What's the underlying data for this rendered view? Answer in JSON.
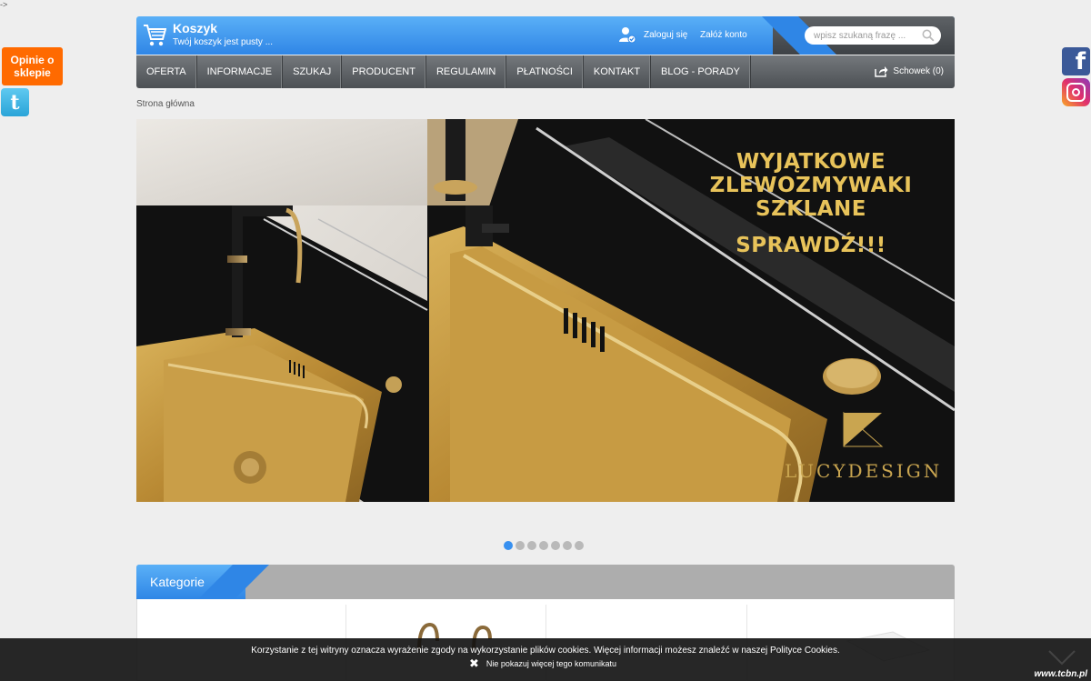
{
  "corner_mark": "->",
  "left_float": {
    "opinie_label": "Opinie o sklepie",
    "twitter_icon": "twitter-icon",
    "twitter_glyph": "t"
  },
  "right_float": {
    "facebook_icon": "facebook-icon",
    "facebook_glyph": "f",
    "instagram_icon": "instagram-icon"
  },
  "header": {
    "cart_title": "Koszyk",
    "cart_status": "Twój koszyk jest pusty ...",
    "login_label": "Zaloguj się",
    "register_label": "Załóż konto",
    "search_placeholder": "wpisz szukaną frazę ..."
  },
  "nav": {
    "items": [
      "OFERTA",
      "INFORMACJE",
      "SZUKAJ",
      "PRODUCENT",
      "REGULAMIN",
      "PŁATNOŚCI",
      "KONTAKT",
      "BLOG - PORADY"
    ],
    "clipboard_label": "Schowek (0)"
  },
  "breadcrumb": "Strona główna",
  "banner": {
    "headline_line1": "WYJĄTKOWE",
    "headline_line2": "ZLEWOZMYWAKI",
    "headline_line3": "SZKLANE",
    "cta": "SPRAWDŹ!!!",
    "brand": "LUCYDESIGN"
  },
  "slider": {
    "dot_count": 7,
    "active_index": 0
  },
  "categories": {
    "title": "Kategorie"
  },
  "cookie": {
    "message": "Korzystanie z tej witryny oznacza wyrażenie zgody na wykorzystanie plików cookies. Więcej informacji możesz znaleźć w naszej Polityce Cookies.",
    "dismiss_label": "Nie pokazuj więcej tego komunikatu"
  },
  "footer_credit": "www.tcbn.pl",
  "colors": {
    "accent_blue": "#2f86e6",
    "orange": "#ff6a00",
    "gold": "#e8c35a",
    "nav_dark": "#4c5054"
  }
}
